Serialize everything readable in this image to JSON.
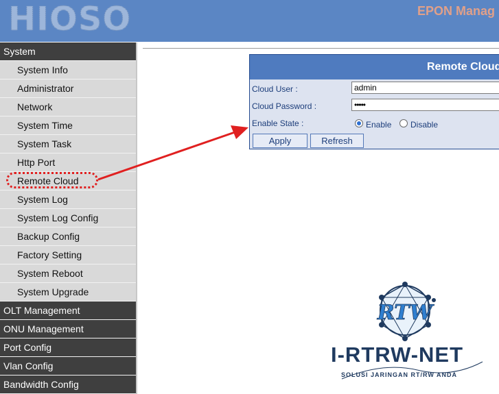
{
  "header": {
    "logo_text": "HIOSO",
    "app_title": "EPON Manag"
  },
  "sidebar": {
    "items": [
      {
        "label": "System",
        "type": "group"
      },
      {
        "label": "System Info",
        "type": "sub"
      },
      {
        "label": "Administrator",
        "type": "sub"
      },
      {
        "label": "Network",
        "type": "sub"
      },
      {
        "label": "System Time",
        "type": "sub"
      },
      {
        "label": "System Task",
        "type": "sub"
      },
      {
        "label": "Http Port",
        "type": "sub"
      },
      {
        "label": "Remote Cloud",
        "type": "sub"
      },
      {
        "label": "System Log",
        "type": "sub"
      },
      {
        "label": "System Log Config",
        "type": "sub"
      },
      {
        "label": "Backup Config",
        "type": "sub"
      },
      {
        "label": "Factory Setting",
        "type": "sub"
      },
      {
        "label": "System Reboot",
        "type": "sub"
      },
      {
        "label": "System Upgrade",
        "type": "sub"
      },
      {
        "label": "OLT Management",
        "type": "group"
      },
      {
        "label": "ONU Management",
        "type": "group"
      },
      {
        "label": "Port Config",
        "type": "group"
      },
      {
        "label": "Vlan Config",
        "type": "group"
      },
      {
        "label": "Bandwidth Config",
        "type": "group"
      }
    ]
  },
  "panel": {
    "title": "Remote Cloud",
    "cloud_user_label": "Cloud User :",
    "cloud_user_value": "admin",
    "cloud_password_label": "Cloud Password :",
    "cloud_password_value": "•••••",
    "enable_state_label": "Enable State :",
    "enable_label": "Enable",
    "disable_label": "Disable",
    "enable_selected": true,
    "apply_label": "Apply",
    "refresh_label": "Refresh"
  },
  "watermark": {
    "name": "I-RTRW-NET",
    "tagline": "SOLUSI JARINGAN RT/RW ANDA",
    "monogram": "RTW"
  },
  "colors": {
    "header_bg": "#5b86c4",
    "group_bg": "#3f3f3f",
    "sub_bg": "#d9d9d9",
    "panel_title_bg": "#4f7bbf",
    "annotation": "#e02020"
  }
}
